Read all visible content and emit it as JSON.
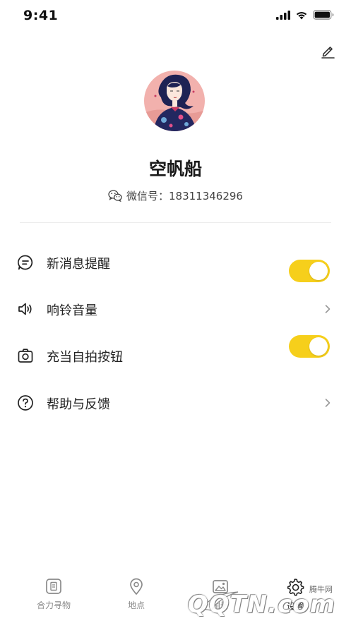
{
  "status_bar": {
    "time": "9:41"
  },
  "profile": {
    "name": "空帆船",
    "wechat_label": "微信号：18311346296"
  },
  "settings": [
    {
      "label": "新消息提醒",
      "icon": "message-bubble-icon",
      "control": "toggle",
      "enabled": true
    },
    {
      "label": "响铃音量",
      "icon": "speaker-icon",
      "control": "chevron"
    },
    {
      "label": "充当自拍按钮",
      "icon": "camera-icon",
      "control": "toggle",
      "enabled": true
    },
    {
      "label": "帮助与反馈",
      "icon": "help-circle-icon",
      "control": "chevron"
    }
  ],
  "tabs": [
    {
      "label": "合力寻物",
      "icon": "box-icon"
    },
    {
      "label": "地点",
      "icon": "location-pin-icon"
    },
    {
      "label": "相册",
      "icon": "photo-album-icon"
    },
    {
      "label": "设置",
      "icon": "gear-icon",
      "active": true
    }
  ],
  "watermark": {
    "site": "腾牛网",
    "brand": "QQTN.com"
  },
  "colors": {
    "toggle_on": "#f6cf1b",
    "text_primary": "#222222",
    "tab_inactive": "#8a8a8a"
  }
}
